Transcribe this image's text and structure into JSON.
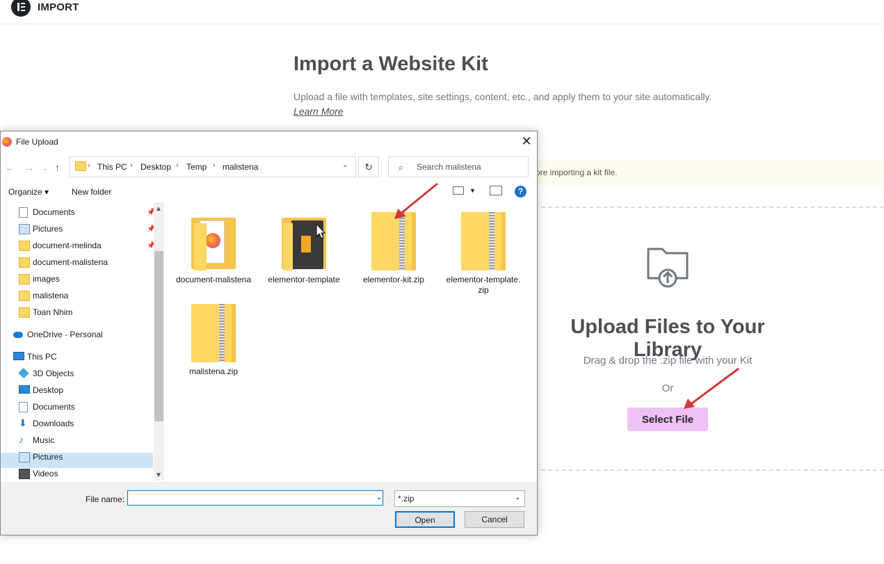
{
  "elementor": {
    "topbar_title": "IMPORT",
    "page_title": "Import a Website Kit",
    "description": "Upload a file with templates, site settings, content, etc., and apply them to your site automatically.",
    "learn_more": "Learn More",
    "notice_text": "ore importing a kit file.",
    "upload_title": "Upload Files to Your Library",
    "upload_desc": "Drag & drop the .zip file with your Kit",
    "or_text": "Or",
    "select_file_label": "Select File",
    "accent_color": "#f0c1f7"
  },
  "dialog": {
    "title": "File Upload",
    "close_glyph": "✕",
    "path": [
      "This PC",
      "Desktop",
      "Temp",
      "malistena"
    ],
    "search_placeholder": "Search malistena",
    "organize_label": "Organize ▾",
    "new_folder_label": "New folder",
    "help_glyph": "?",
    "nav_items": [
      {
        "label": "Documents",
        "icon": "documents-icon",
        "pinned": true
      },
      {
        "label": "Pictures",
        "icon": "pictures-icon",
        "pinned": true
      },
      {
        "label": "document-melinda",
        "icon": "folder-icon",
        "pinned": true
      },
      {
        "label": "document-malistena",
        "icon": "folder-icon",
        "pinned": false
      },
      {
        "label": "images",
        "icon": "folder-icon",
        "pinned": false
      },
      {
        "label": "malistena",
        "icon": "folder-icon",
        "pinned": false
      },
      {
        "label": "Toan Nhim",
        "icon": "folder-icon",
        "pinned": false
      },
      {
        "label": "OneDrive - Personal",
        "icon": "onedrive-icon",
        "pinned": false
      },
      {
        "label": "This PC",
        "icon": "this-pc-icon",
        "pinned": false
      },
      {
        "label": "3D Objects",
        "icon": "3d-objects-icon",
        "pinned": false
      },
      {
        "label": "Desktop",
        "icon": "desktop-icon",
        "pinned": false,
        "selected": true
      },
      {
        "label": "Documents",
        "icon": "documents-icon",
        "pinned": false
      },
      {
        "label": "Downloads",
        "icon": "downloads-icon",
        "pinned": false
      },
      {
        "label": "Music",
        "icon": "music-icon",
        "pinned": false
      },
      {
        "label": "Pictures",
        "icon": "pictures-icon",
        "pinned": false
      },
      {
        "label": "Videos",
        "icon": "videos-icon",
        "pinned": false
      }
    ],
    "files": [
      {
        "name": "document-malistena",
        "type": "folder"
      },
      {
        "name": "elementor-template",
        "type": "folder"
      },
      {
        "name": "elementor-kit.zip",
        "type": "zip"
      },
      {
        "name": "elementor-template.zip",
        "type": "zip"
      },
      {
        "name": "malistena.zip",
        "type": "zip"
      }
    ],
    "file_name_label": "File name:",
    "file_name_value": "",
    "file_type": "*.zip",
    "open_label": "Open",
    "cancel_label": "Cancel"
  },
  "annotation_arrow_color": "#d63638"
}
